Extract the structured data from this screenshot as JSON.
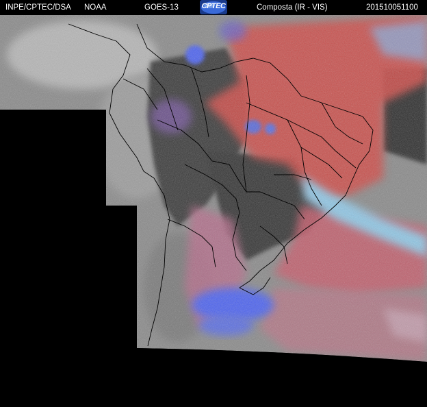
{
  "header": {
    "org": "INPE/CPTEC/DSA",
    "agency": "NOAA",
    "satellite": "GOES-13",
    "logo_text": "CPTEC",
    "product": "Composta (IR - VIS)",
    "timestamp": "201510051100"
  },
  "palette": {
    "background": "#000000",
    "ir_gray": "#8c8c8c",
    "land_dark": "#3a3a3a",
    "vis_red": "#d04a46",
    "vis_pink": "#c2607a",
    "cloud_blue": "#4f63e8",
    "cloud_cyan": "#8fc4e6",
    "borders": "#000000"
  }
}
